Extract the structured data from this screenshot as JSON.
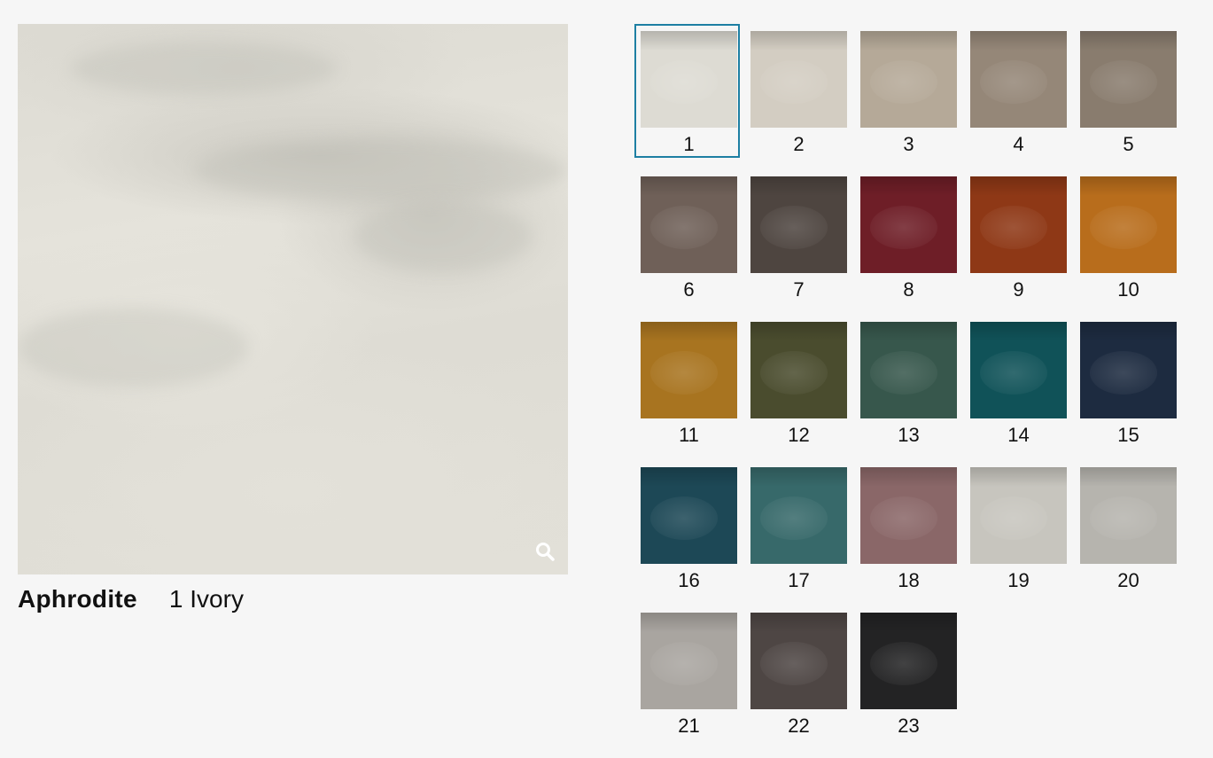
{
  "product": {
    "name": "Aphrodite",
    "selected_variant": "1 Ivory"
  },
  "icons": {
    "zoom": "search-icon"
  },
  "selected_index": 0,
  "swatches": [
    {
      "number": "1",
      "color": "#dddbd3"
    },
    {
      "number": "2",
      "color": "#d3cdc2"
    },
    {
      "number": "3",
      "color": "#b5a998"
    },
    {
      "number": "4",
      "color": "#958778"
    },
    {
      "number": "5",
      "color": "#897c6e"
    },
    {
      "number": "6",
      "color": "#6f6058"
    },
    {
      "number": "7",
      "color": "#4e4540"
    },
    {
      "number": "8",
      "color": "#6e1e27"
    },
    {
      "number": "9",
      "color": "#8e3816"
    },
    {
      "number": "10",
      "color": "#b86d1c"
    },
    {
      "number": "11",
      "color": "#a87420"
    },
    {
      "number": "12",
      "color": "#4a4c2e"
    },
    {
      "number": "13",
      "color": "#37574c"
    },
    {
      "number": "14",
      "color": "#105258"
    },
    {
      "number": "15",
      "color": "#1d2b40"
    },
    {
      "number": "16",
      "color": "#1d4856"
    },
    {
      "number": "17",
      "color": "#37696a"
    },
    {
      "number": "18",
      "color": "#8a6768"
    },
    {
      "number": "19",
      "color": "#c7c5be"
    },
    {
      "number": "20",
      "color": "#b6b4ae"
    },
    {
      "number": "21",
      "color": "#a9a5a0"
    },
    {
      "number": "22",
      "color": "#4e4644"
    },
    {
      "number": "23",
      "color": "#232324"
    }
  ]
}
